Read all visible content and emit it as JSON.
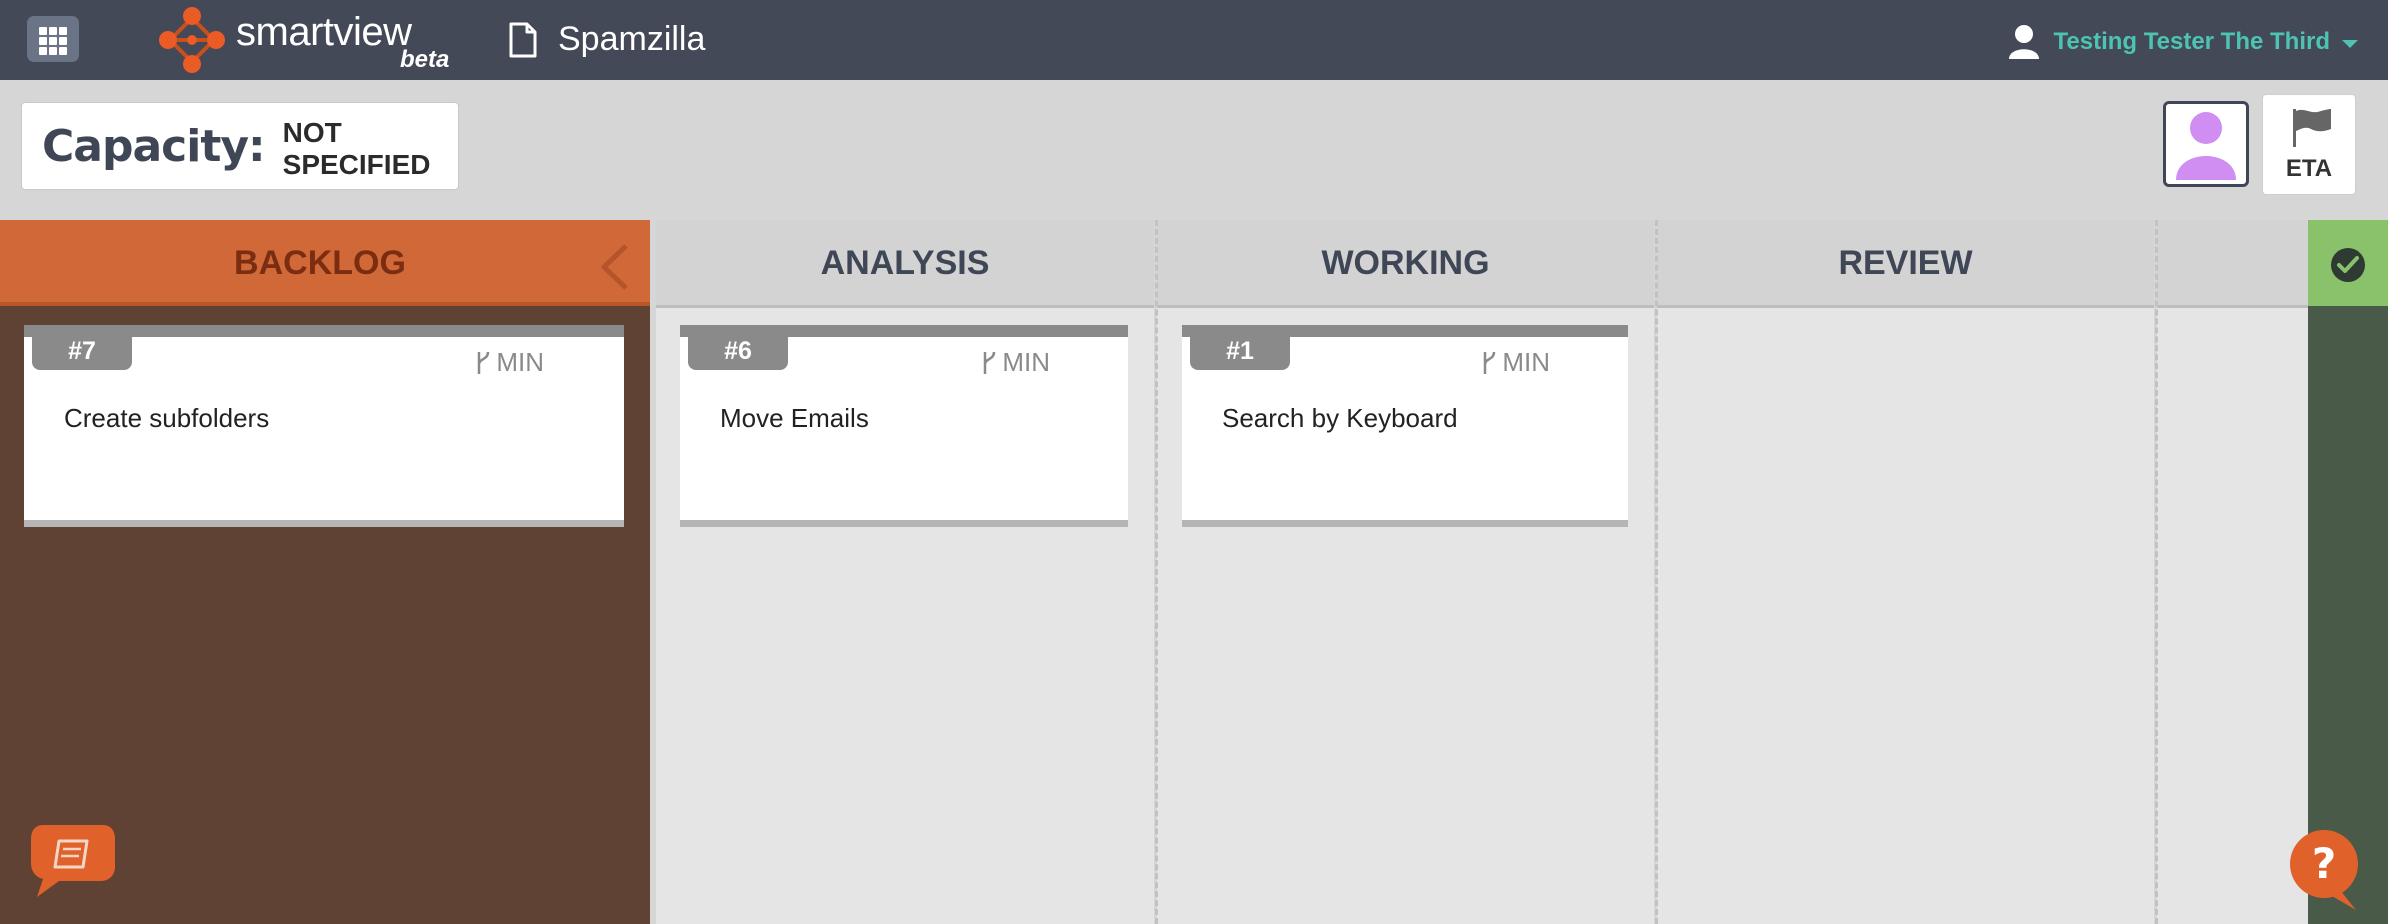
{
  "app": {
    "name": "smartview",
    "badge": "beta",
    "project_title": "Spamzilla"
  },
  "user": {
    "name": "Testing Tester The Third"
  },
  "toolbar": {
    "capacity_label": "Capacity:",
    "capacity_value": "NOT SPECIFIED",
    "eta_label": "ETA"
  },
  "columns": [
    {
      "title": "BACKLOG"
    },
    {
      "title": "ANALYSIS"
    },
    {
      "title": "WORKING"
    },
    {
      "title": "REVIEW"
    }
  ],
  "cards": [
    {
      "id": "#7",
      "estimate": "MIN",
      "title": "Create subfolders"
    },
    {
      "id": "#6",
      "estimate": "MIN",
      "title": "Move Emails"
    },
    {
      "id": "#1",
      "estimate": "MIN",
      "title": "Search by Keyboard"
    }
  ],
  "colors": {
    "topbar": "#434957",
    "accent_teal": "#4dc4b3",
    "backlog_header": "#d06937",
    "backlog_body": "#5f4234",
    "done_green": "#8ac26b",
    "avatar_purple": "#d08ef2"
  },
  "icons": [
    "apps-grid-icon",
    "smartview-logo-icon",
    "document-icon",
    "user-icon",
    "caret-down-icon",
    "user-avatar-icon",
    "flag-icon",
    "chevron-left-icon",
    "checkmark-icon",
    "branch-icon",
    "feedback-book-icon",
    "help-question-icon"
  ]
}
